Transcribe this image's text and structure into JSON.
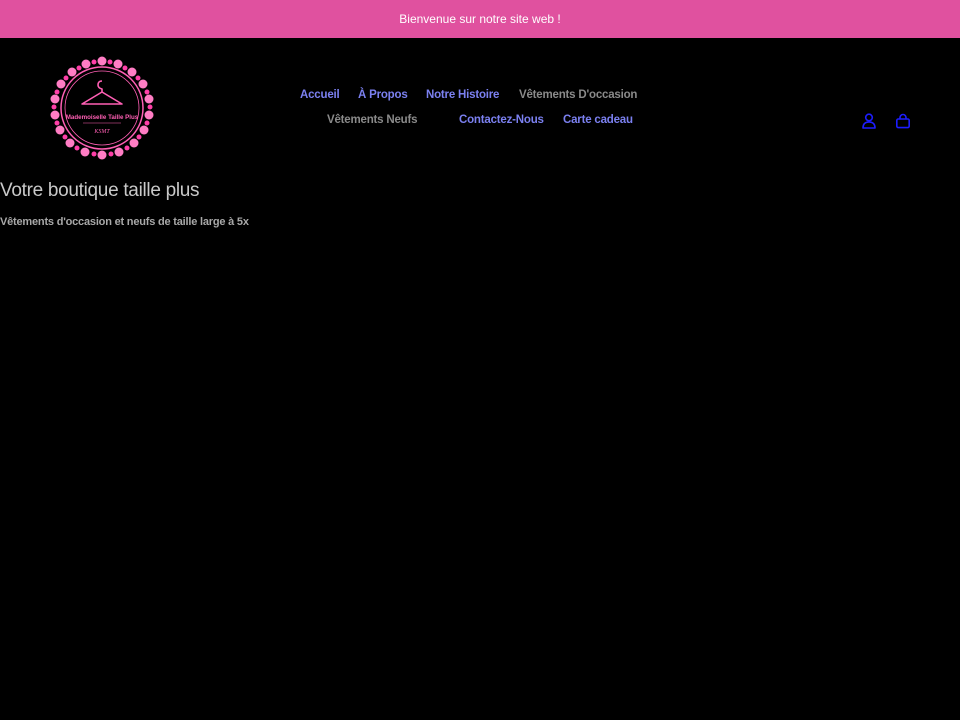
{
  "announcement": {
    "text": "Bienvenue sur notre site web !"
  },
  "logo": {
    "line1": "Mademoiselle Taille Plus",
    "line2": "KSMT"
  },
  "nav": {
    "items": [
      {
        "label": "Accueil"
      },
      {
        "label": "À Propos"
      },
      {
        "label": "Notre Histoire"
      },
      {
        "label": "Vêtements D'occasion"
      },
      {
        "label": "Vêtements Neufs"
      },
      {
        "label": "Contactez-Nous"
      },
      {
        "label": "Carte cadeau"
      }
    ]
  },
  "header_icons": {
    "account": "account-icon",
    "cart": "cart-icon"
  },
  "hero": {
    "title": "Votre boutique taille plus",
    "subtitle": "Vêtements d'occasion et neufs de taille large à 5x"
  },
  "colors": {
    "announcement_bg": "#e0519f",
    "background": "#000000",
    "nav_link": "#7b80f0",
    "nav_link_muted": "#8a8a8a",
    "icon": "#1d1dff",
    "logo_pink": "#ff5fb4"
  }
}
